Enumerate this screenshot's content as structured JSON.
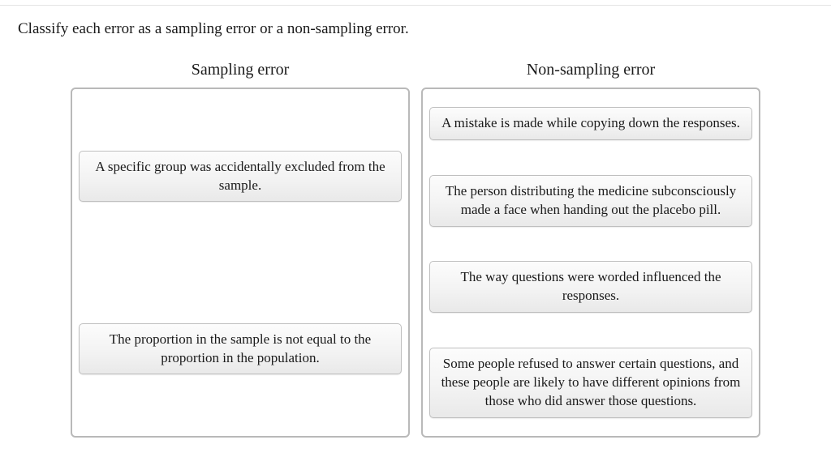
{
  "instruction": "Classify each error as a sampling error or a non-sampling error.",
  "columns": {
    "sampling": {
      "title": "Sampling error",
      "cards": [
        "A specific group was accidentally excluded from the sample.",
        "The proportion in the sample is not equal to the proportion in the population."
      ]
    },
    "nonsampling": {
      "title": "Non-sampling error",
      "cards": [
        "A mistake is made while copying down the responses.",
        "The person distributing the medicine subconsciously made a face when handing out the placebo pill.",
        "The way questions were worded influenced the responses.",
        "Some people refused to answer certain questions, and these people are likely to have different opinions from those who did answer those questions."
      ]
    }
  }
}
